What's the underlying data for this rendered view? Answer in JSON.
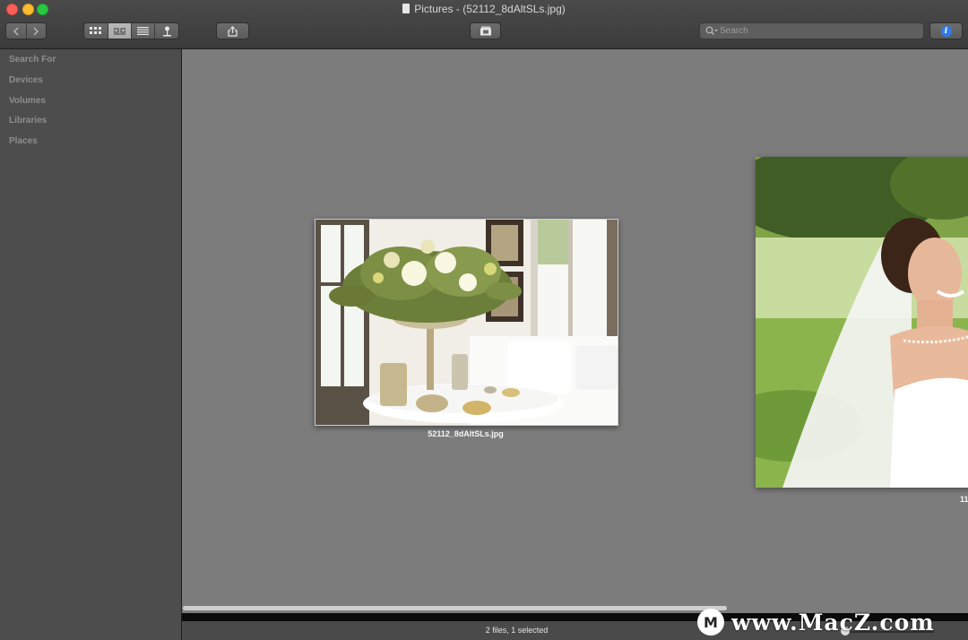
{
  "window": {
    "title": "Pictures - (52112_8dAltSLs.jpg)"
  },
  "toolbar": {
    "back_icon": "chevron-left",
    "forward_icon": "chevron-right",
    "view_modes": [
      "grid",
      "coverflow",
      "list",
      "map"
    ],
    "active_view": "coverflow",
    "share_icon": "share",
    "slideshow_icon": "slideshow",
    "search_placeholder": "Search",
    "info_icon": "info",
    "info_glyph": "i"
  },
  "sidebar": {
    "sections": [
      "Search For",
      "Devices",
      "Volumes",
      "Libraries",
      "Places"
    ]
  },
  "browser": {
    "files": [
      {
        "name": "52112_8dAltSLs.jpg",
        "selected": true
      },
      {
        "name": "11",
        "selected": false
      }
    ]
  },
  "status": {
    "text": "2 files, 1 selected"
  },
  "watermark": {
    "logo_letter": "M",
    "text": "www.MacZ.com"
  },
  "colors": {
    "info_accent": "#2f7be7",
    "main_background": "#7c7c7c",
    "sidebar_background": "#4d4d4d"
  }
}
